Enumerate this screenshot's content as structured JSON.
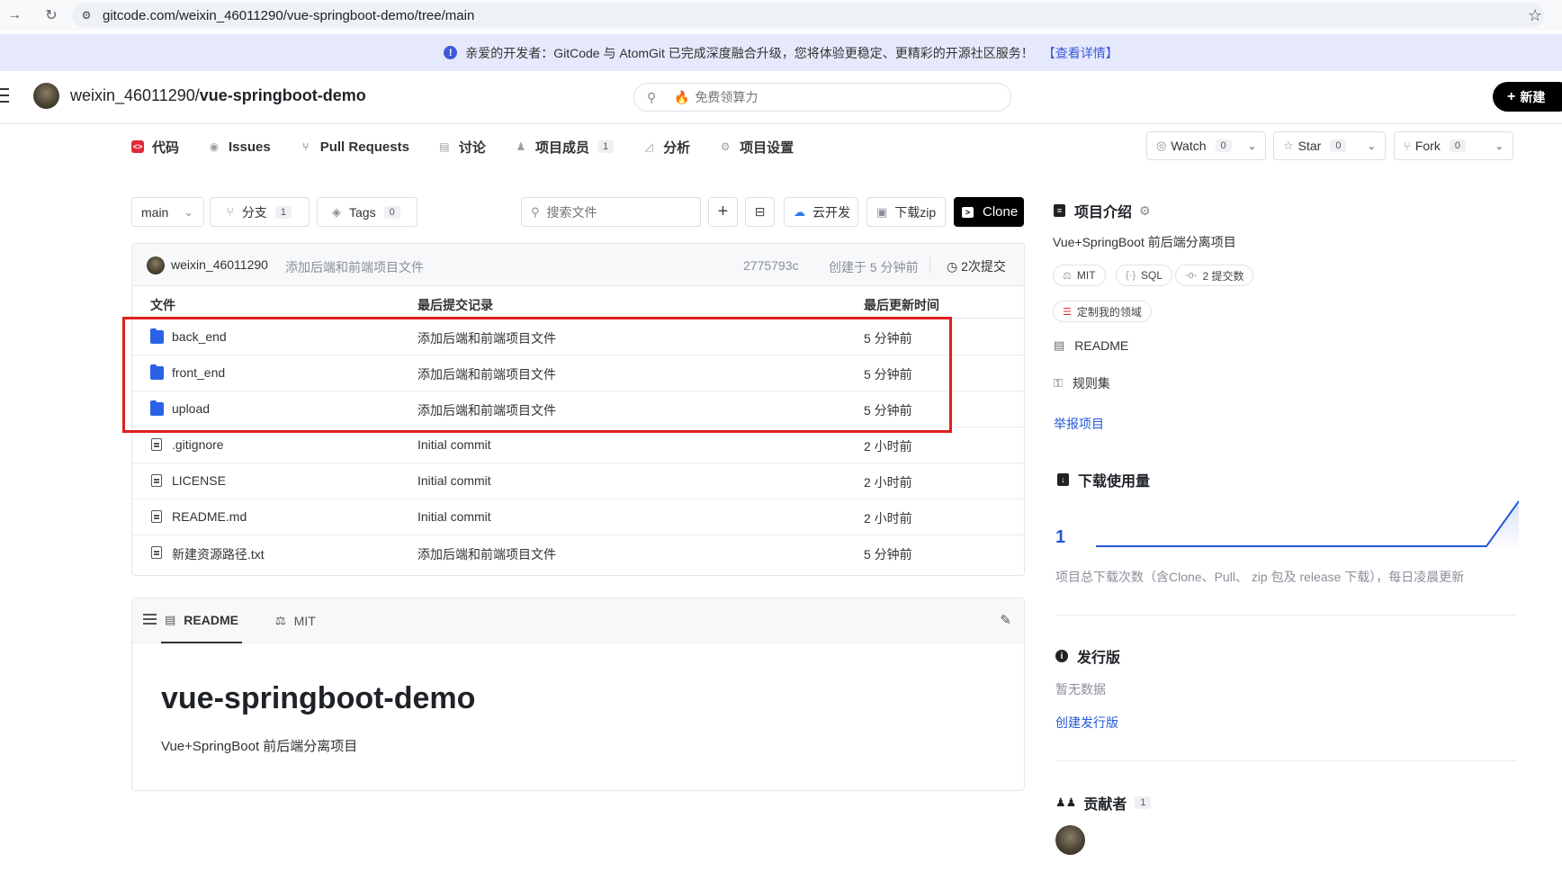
{
  "browser": {
    "url": "gitcode.com/weixin_46011290/vue-springboot-demo/tree/main"
  },
  "banner": {
    "text": "亲爱的开发者：GitCode 与 AtomGit 已完成深度融合升级，您将体验更稳定、更精彩的开源社区服务！",
    "link": "【查看详情】"
  },
  "header": {
    "owner": "weixin_46011290/",
    "repo": "vue-springboot-demo",
    "search_placeholder": "免费领算力",
    "new_label": "新建"
  },
  "tabs": [
    {
      "label": "代码",
      "icon": "code-icon"
    },
    {
      "label": "Issues",
      "icon": "issues-icon"
    },
    {
      "label": "Pull Requests",
      "icon": "pull-request-icon"
    },
    {
      "label": "讨论",
      "icon": "discussion-icon"
    },
    {
      "label": "项目成员",
      "icon": "members-icon",
      "count": "1"
    },
    {
      "label": "分析",
      "icon": "analytics-icon"
    },
    {
      "label": "项目设置",
      "icon": "settings-icon"
    }
  ],
  "repo_actions": {
    "watch": {
      "label": "Watch",
      "count": "0"
    },
    "star": {
      "label": "Star",
      "count": "0"
    },
    "fork": {
      "label": "Fork",
      "count": "0"
    }
  },
  "toolbar": {
    "branch": "main",
    "branches_label": "分支",
    "branches_count": "1",
    "tags_label": "Tags",
    "tags_count": "0",
    "search_placeholder": "搜索文件",
    "cloud_dev": "云开发",
    "download_zip": "下载zip",
    "clone": "Clone"
  },
  "commit": {
    "author": "weixin_46011290",
    "message": "添加后端和前端项目文件",
    "hash": "2775793c",
    "time": "创建于 5 分钟前",
    "count": "2次提交"
  },
  "file_table": {
    "headers": [
      "文件",
      "最后提交记录",
      "最后更新时间"
    ],
    "rows": [
      {
        "name": "back_end",
        "type": "folder",
        "commit": "添加后端和前端项目文件",
        "time": "5 分钟前"
      },
      {
        "name": "front_end",
        "type": "folder",
        "commit": "添加后端和前端项目文件",
        "time": "5 分钟前"
      },
      {
        "name": "upload",
        "type": "folder",
        "commit": "添加后端和前端项目文件",
        "time": "5 分钟前"
      },
      {
        "name": ".gitignore",
        "type": "file",
        "commit": "Initial commit",
        "time": "2 小时前"
      },
      {
        "name": "LICENSE",
        "type": "file",
        "commit": "Initial commit",
        "time": "2 小时前"
      },
      {
        "name": "README.md",
        "type": "file",
        "commit": "Initial commit",
        "time": "2 小时前"
      },
      {
        "name": "新建资源路径.txt",
        "type": "file",
        "commit": "添加后端和前端项目文件",
        "time": "5 分钟前"
      }
    ]
  },
  "readme": {
    "tab_readme": "README",
    "tab_license": "MIT",
    "title": "vue-springboot-demo",
    "description": "Vue+SpringBoot 前后端分离项目"
  },
  "sidebar": {
    "intro_title": "项目介绍",
    "intro_desc": "Vue+SpringBoot 前后端分离项目",
    "pills": [
      "MIT",
      "SQL",
      "2 提交数"
    ],
    "customize": "定制我的领域",
    "readme_link": "README",
    "rules_link": "规则集",
    "report": "举报项目",
    "downloads_title": "下载使用量",
    "downloads_count": "1",
    "downloads_note": "项目总下载次数（含Clone、Pull、 zip 包及 release 下载），每日凌晨更新",
    "release_title": "发行版",
    "release_empty": "暂无数据",
    "release_create": "创建发行版",
    "contrib_title": "贡献者",
    "contrib_count": "1"
  },
  "colors": {
    "accent": "#2558d8",
    "active_tab_icon": "#e0283a",
    "highlight": "#e01e1e",
    "folder": "#2962e6"
  }
}
